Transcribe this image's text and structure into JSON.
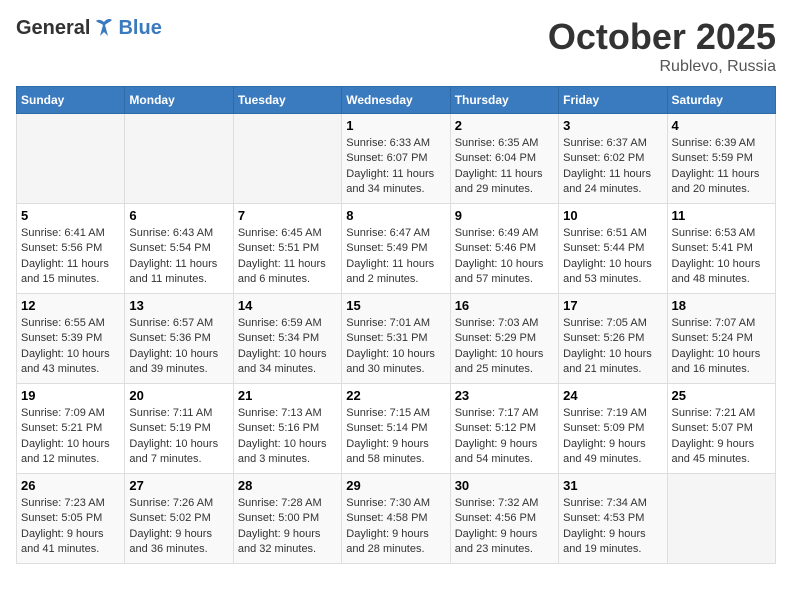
{
  "header": {
    "logo": {
      "general": "General",
      "blue": "Blue"
    },
    "title": "October 2025",
    "location": "Rublevo, Russia"
  },
  "weekdays": [
    "Sunday",
    "Monday",
    "Tuesday",
    "Wednesday",
    "Thursday",
    "Friday",
    "Saturday"
  ],
  "weeks": [
    [
      {
        "day": "",
        "content": ""
      },
      {
        "day": "",
        "content": ""
      },
      {
        "day": "",
        "content": ""
      },
      {
        "day": "1",
        "content": "Sunrise: 6:33 AM\nSunset: 6:07 PM\nDaylight: 11 hours\nand 34 minutes."
      },
      {
        "day": "2",
        "content": "Sunrise: 6:35 AM\nSunset: 6:04 PM\nDaylight: 11 hours\nand 29 minutes."
      },
      {
        "day": "3",
        "content": "Sunrise: 6:37 AM\nSunset: 6:02 PM\nDaylight: 11 hours\nand 24 minutes."
      },
      {
        "day": "4",
        "content": "Sunrise: 6:39 AM\nSunset: 5:59 PM\nDaylight: 11 hours\nand 20 minutes."
      }
    ],
    [
      {
        "day": "5",
        "content": "Sunrise: 6:41 AM\nSunset: 5:56 PM\nDaylight: 11 hours\nand 15 minutes."
      },
      {
        "day": "6",
        "content": "Sunrise: 6:43 AM\nSunset: 5:54 PM\nDaylight: 11 hours\nand 11 minutes."
      },
      {
        "day": "7",
        "content": "Sunrise: 6:45 AM\nSunset: 5:51 PM\nDaylight: 11 hours\nand 6 minutes."
      },
      {
        "day": "8",
        "content": "Sunrise: 6:47 AM\nSunset: 5:49 PM\nDaylight: 11 hours\nand 2 minutes."
      },
      {
        "day": "9",
        "content": "Sunrise: 6:49 AM\nSunset: 5:46 PM\nDaylight: 10 hours\nand 57 minutes."
      },
      {
        "day": "10",
        "content": "Sunrise: 6:51 AM\nSunset: 5:44 PM\nDaylight: 10 hours\nand 53 minutes."
      },
      {
        "day": "11",
        "content": "Sunrise: 6:53 AM\nSunset: 5:41 PM\nDaylight: 10 hours\nand 48 minutes."
      }
    ],
    [
      {
        "day": "12",
        "content": "Sunrise: 6:55 AM\nSunset: 5:39 PM\nDaylight: 10 hours\nand 43 minutes."
      },
      {
        "day": "13",
        "content": "Sunrise: 6:57 AM\nSunset: 5:36 PM\nDaylight: 10 hours\nand 39 minutes."
      },
      {
        "day": "14",
        "content": "Sunrise: 6:59 AM\nSunset: 5:34 PM\nDaylight: 10 hours\nand 34 minutes."
      },
      {
        "day": "15",
        "content": "Sunrise: 7:01 AM\nSunset: 5:31 PM\nDaylight: 10 hours\nand 30 minutes."
      },
      {
        "day": "16",
        "content": "Sunrise: 7:03 AM\nSunset: 5:29 PM\nDaylight: 10 hours\nand 25 minutes."
      },
      {
        "day": "17",
        "content": "Sunrise: 7:05 AM\nSunset: 5:26 PM\nDaylight: 10 hours\nand 21 minutes."
      },
      {
        "day": "18",
        "content": "Sunrise: 7:07 AM\nSunset: 5:24 PM\nDaylight: 10 hours\nand 16 minutes."
      }
    ],
    [
      {
        "day": "19",
        "content": "Sunrise: 7:09 AM\nSunset: 5:21 PM\nDaylight: 10 hours\nand 12 minutes."
      },
      {
        "day": "20",
        "content": "Sunrise: 7:11 AM\nSunset: 5:19 PM\nDaylight: 10 hours\nand 7 minutes."
      },
      {
        "day": "21",
        "content": "Sunrise: 7:13 AM\nSunset: 5:16 PM\nDaylight: 10 hours\nand 3 minutes."
      },
      {
        "day": "22",
        "content": "Sunrise: 7:15 AM\nSunset: 5:14 PM\nDaylight: 9 hours\nand 58 minutes."
      },
      {
        "day": "23",
        "content": "Sunrise: 7:17 AM\nSunset: 5:12 PM\nDaylight: 9 hours\nand 54 minutes."
      },
      {
        "day": "24",
        "content": "Sunrise: 7:19 AM\nSunset: 5:09 PM\nDaylight: 9 hours\nand 49 minutes."
      },
      {
        "day": "25",
        "content": "Sunrise: 7:21 AM\nSunset: 5:07 PM\nDaylight: 9 hours\nand 45 minutes."
      }
    ],
    [
      {
        "day": "26",
        "content": "Sunrise: 7:23 AM\nSunset: 5:05 PM\nDaylight: 9 hours\nand 41 minutes."
      },
      {
        "day": "27",
        "content": "Sunrise: 7:26 AM\nSunset: 5:02 PM\nDaylight: 9 hours\nand 36 minutes."
      },
      {
        "day": "28",
        "content": "Sunrise: 7:28 AM\nSunset: 5:00 PM\nDaylight: 9 hours\nand 32 minutes."
      },
      {
        "day": "29",
        "content": "Sunrise: 7:30 AM\nSunset: 4:58 PM\nDaylight: 9 hours\nand 28 minutes."
      },
      {
        "day": "30",
        "content": "Sunrise: 7:32 AM\nSunset: 4:56 PM\nDaylight: 9 hours\nand 23 minutes."
      },
      {
        "day": "31",
        "content": "Sunrise: 7:34 AM\nSunset: 4:53 PM\nDaylight: 9 hours\nand 19 minutes."
      },
      {
        "day": "",
        "content": ""
      }
    ]
  ]
}
